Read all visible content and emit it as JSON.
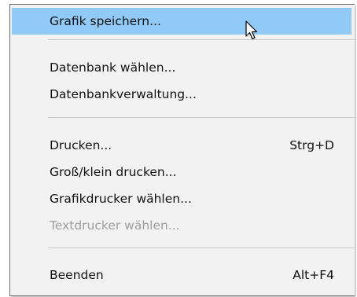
{
  "menu": {
    "items": [
      {
        "label": "Grafik speichern...",
        "shortcut": "",
        "state": "highlighted"
      },
      {
        "label": "Datenbank wählen...",
        "shortcut": ""
      },
      {
        "label": "Datenbankverwaltung...",
        "shortcut": ""
      },
      {
        "label": "Drucken...",
        "shortcut": "Strg+D"
      },
      {
        "label": "Groß/klein drucken...",
        "shortcut": ""
      },
      {
        "label": "Grafikdrucker wählen...",
        "shortcut": ""
      },
      {
        "label": "Textdrucker wählen...",
        "shortcut": "",
        "state": "disabled"
      },
      {
        "label": "Beenden",
        "shortcut": "Alt+F4"
      }
    ]
  },
  "colors": {
    "highlight": "#91c9f7",
    "disabled_text": "#9e9e9e",
    "menu_background": "#f2f2f2"
  },
  "cursor": {
    "icon": "arrow-pointer-icon"
  }
}
